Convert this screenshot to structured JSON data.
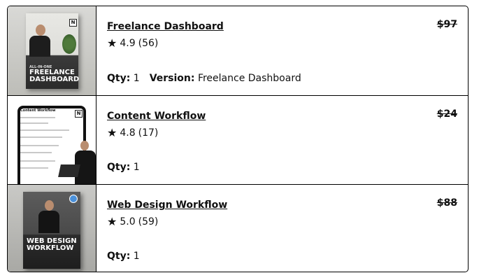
{
  "products": [
    {
      "title": "Freelance Dashboard",
      "price": "$97",
      "rating_value": "4.9",
      "rating_count": "(56)",
      "qty_label": "Qty:",
      "qty_value": "1",
      "version_label": "Version:",
      "version_value": "Freelance Dashboard",
      "thumb": {
        "small_text": "ALL-IN-ONE",
        "big_text": "FREELANCE DASHBOARD"
      }
    },
    {
      "title": "Content Workflow",
      "price": "$24",
      "rating_value": "4.8",
      "rating_count": "(17)",
      "qty_label": "Qty:",
      "qty_value": "1",
      "thumb": {
        "doc_title": "Content Workflow"
      }
    },
    {
      "title": "Web Design Workflow",
      "price": "$88",
      "rating_value": "5.0",
      "rating_count": "(59)",
      "qty_label": "Qty:",
      "qty_value": "1",
      "thumb": {
        "big_text": "WEB DESIGN WORKFLOW"
      }
    }
  ],
  "icons": {
    "star": "star-icon",
    "logo": "notion-logo-icon"
  }
}
